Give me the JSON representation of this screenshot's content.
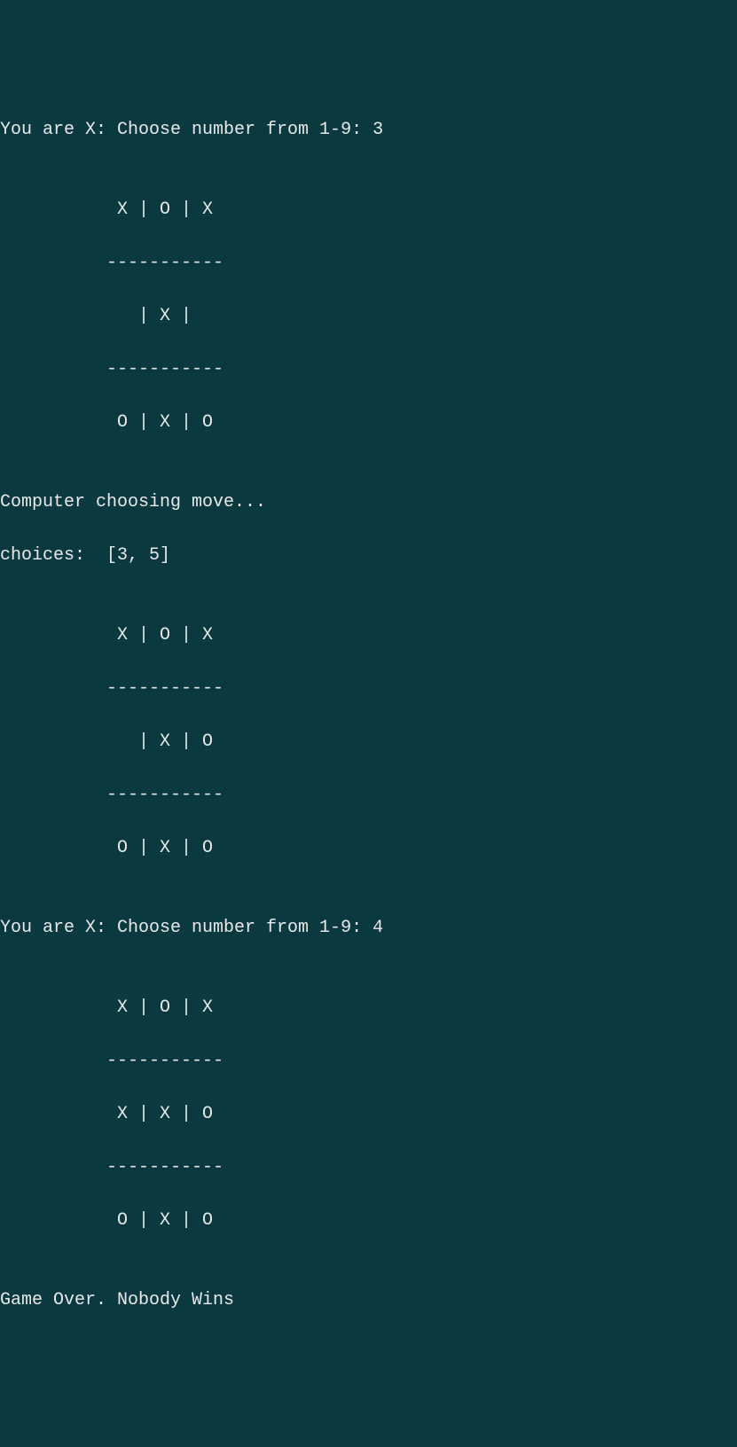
{
  "lines": {
    "prompt1": "You are X: Choose number from 1-9: 3",
    "blank": "",
    "board1_r1": "           X | O | X",
    "board1_div1": "          -----------",
    "board1_r2": "             | X |  ",
    "board1_div2": "          -----------",
    "board1_r3": "           O | X | O",
    "computer_move": "Computer choosing move...",
    "choices": "choices:  [3, 5]",
    "board2_r1": "           X | O | X",
    "board2_div1": "          -----------",
    "board2_r2": "             | X | O",
    "board2_div2": "          -----------",
    "board2_r3": "           O | X | O",
    "prompt2": "You are X: Choose number from 1-9: 4",
    "board3_r1": "           X | O | X",
    "board3_div1": "          -----------",
    "board3_r2": "           X | X | O",
    "board3_div2": "          -----------",
    "board3_r3": "           O | X | O",
    "game_over": "Game Over. Nobody Wins"
  }
}
